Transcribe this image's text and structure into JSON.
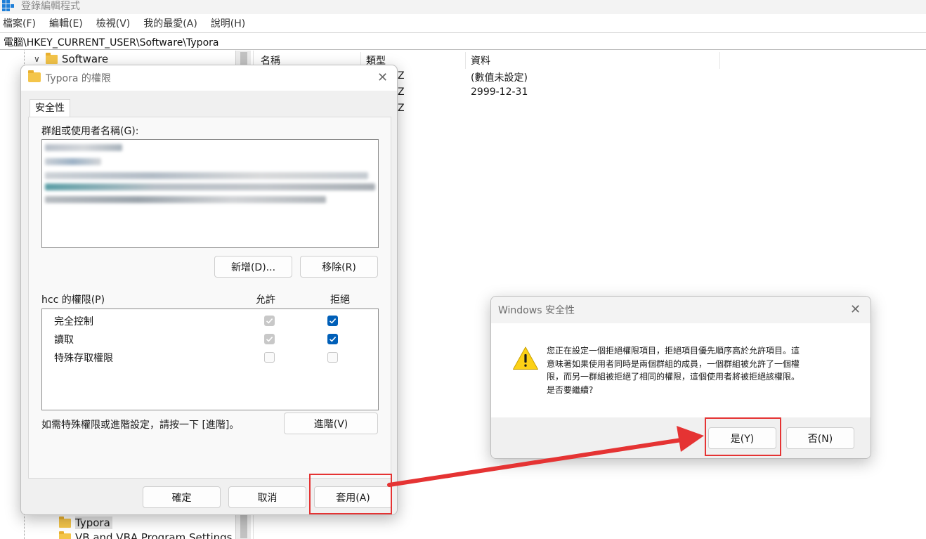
{
  "app": {
    "title": "登錄編輯程式",
    "menu": [
      "檔案(F)",
      "編輯(E)",
      "檢視(V)",
      "我的最愛(A)",
      "說明(H)"
    ],
    "address": "電腦\\HKEY_CURRENT_USER\\Software\\Typora"
  },
  "tree": {
    "software": "Software",
    "typora": "Typora",
    "vb": "VB and VBA Program Settings"
  },
  "list": {
    "columns": [
      "名稱",
      "類型",
      "資料"
    ],
    "rows": [
      {
        "type_fragment": "Z",
        "data": "(數值未設定)"
      },
      {
        "type_fragment": "Z",
        "data": "2999-12-31"
      },
      {
        "type_fragment": "Z",
        "data": ""
      }
    ]
  },
  "perm_dialog": {
    "title": "Typora 的權限",
    "tab": "安全性",
    "group_label": "群組或使用者名稱(G):",
    "add_button": "新增(D)...",
    "remove_button": "移除(R)",
    "perm_label": "hcc 的權限(P)",
    "allow_header": "允許",
    "deny_header": "拒絕",
    "permissions": [
      {
        "name": "完全控制",
        "allow": "checked-disabled",
        "deny": "checked"
      },
      {
        "name": "讀取",
        "allow": "checked-disabled",
        "deny": "checked"
      },
      {
        "name": "特殊存取權限",
        "allow": "unchecked",
        "deny": "unchecked"
      }
    ],
    "advanced_hint": "如需特殊權限或進階設定，請按一下 [進階]。",
    "advanced_button": "進階(V)",
    "ok_button": "確定",
    "cancel_button": "取消",
    "apply_button": "套用(A)"
  },
  "warn_dialog": {
    "title": "Windows 安全性",
    "message_lines": [
      "您正在設定一個拒絕權限項目，拒絕項目優先順序高於允許項目。這",
      "意味著如果使用者同時是兩個群組的成員，一個群組被允許了一個權",
      "限，而另一群組被拒絕了相同的權限，這個使用者將被拒絕該權限。",
      "是否要繼續?"
    ],
    "yes_button": "是(Y)",
    "no_button": "否(N)"
  },
  "colors": {
    "accent_blue": "#005fb8",
    "highlight_red": "#e53333",
    "warning_yellow": "#fcd116"
  }
}
